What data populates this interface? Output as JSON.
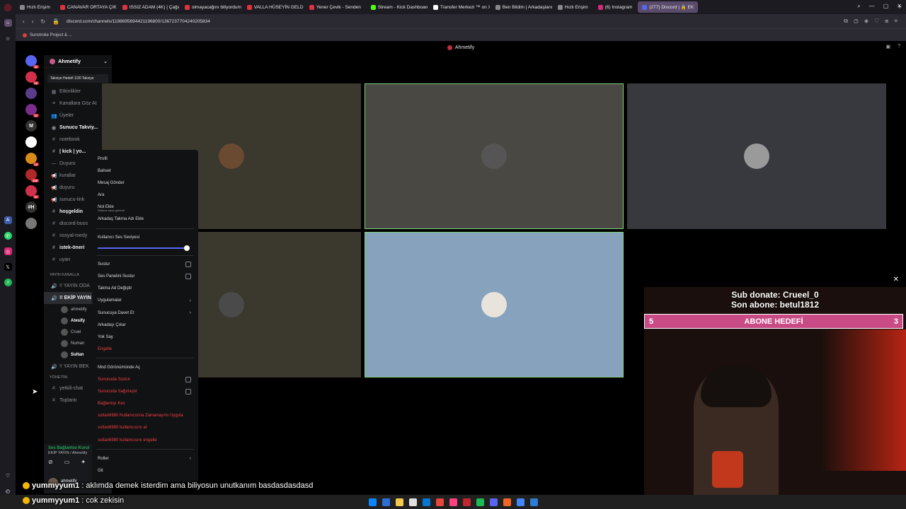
{
  "browser": {
    "tabs": [
      {
        "label": "Hızlı Erişim",
        "color": "#888888"
      },
      {
        "label": "CANAVAR ORTAYA ÇIKTI",
        "color": "#e0333e"
      },
      {
        "label": "ISSIZ ADAM (4K) | Çağan",
        "color": "#e0333e"
      },
      {
        "label": "olmayacağını biliyordum",
        "color": "#e0333e"
      },
      {
        "label": "VALLA HÜSEYİN GELDİ &",
        "color": "#e0333e"
      },
      {
        "label": "Yener Çevik - Senden",
        "color": "#e0333e"
      },
      {
        "label": "Stream - Kick Dashboard",
        "color": "#53fc18"
      },
      {
        "label": "Transfer Merkezi ™ on X",
        "color": "#ffffff"
      },
      {
        "label": "Ben Bildim | Arkadaşlarını",
        "color": "#888888"
      },
      {
        "label": "Hızlı Erişim",
        "color": "#888888"
      },
      {
        "label": "(6) Instagram",
        "color": "#d62976"
      },
      {
        "label": "(277) Discord | 🔒 EK",
        "color": "#5865f2",
        "active": true
      }
    ],
    "url": "discord.com/channels/1198695694421196800/1367237704240205834",
    "bookmark": "Sunstroke Project & ..."
  },
  "discord": {
    "title": "Ahmetify",
    "server_name": "Ahmetify",
    "boost_text": "Takviye Hedefi 1/20 Takviye",
    "guilds": [
      {
        "label": "",
        "badge": "41",
        "color": "#5865f2"
      },
      {
        "label": "",
        "badge": "16",
        "color": "#d0304a"
      },
      {
        "label": "",
        "badge": "",
        "color": "#5a3d8a"
      },
      {
        "label": "",
        "badge": "27",
        "color": "#7a2d8a"
      },
      {
        "label": "M",
        "badge": "",
        "color": "#333333"
      },
      {
        "label": "",
        "badge": "",
        "color": "#ffffff"
      },
      {
        "label": "",
        "badge": "10",
        "color": "#d88a18"
      },
      {
        "label": "",
        "badge": "160",
        "color": "#b02828"
      },
      {
        "label": "",
        "badge": "27",
        "color": "#d0304a"
      },
      {
        "label": "#H",
        "badge": "",
        "color": "#333333"
      },
      {
        "label": "",
        "badge": "",
        "color": "#777777"
      }
    ],
    "channels": [
      {
        "icon": "▦",
        "label": "Etkinlikler",
        "bright": false
      },
      {
        "icon": "≡",
        "label": "Kanallara Göz At",
        "bright": false
      },
      {
        "icon": "👥",
        "label": "Üyeler",
        "bright": false
      },
      {
        "icon": "◉",
        "label": "Sunucu Takviy...",
        "bright": true
      },
      {
        "icon": "#",
        "label": "notebook",
        "bright": false
      },
      {
        "icon": "#",
        "label": "| kick | yo...",
        "bright": true
      },
      {
        "icon": "—",
        "label": "Duyuru",
        "bright": false
      },
      {
        "icon": "📢",
        "label": "kurallar",
        "bright": false
      },
      {
        "icon": "📢",
        "label": "duyuru",
        "bright": false
      },
      {
        "icon": "📢",
        "label": "sunucu-link",
        "bright": false
      },
      {
        "icon": "#",
        "label": "hoşgeldin",
        "bright": true
      },
      {
        "icon": "#",
        "label": "discord-boos",
        "bright": false
      },
      {
        "icon": "#",
        "label": "sosyal-medy",
        "bright": false
      },
      {
        "icon": "#",
        "label": "istek-öneri",
        "bright": true
      },
      {
        "icon": "#",
        "label": "uyarı",
        "bright": false
      }
    ],
    "categories": {
      "yayin": "YAYIN KANALLA",
      "yayin_oda": "!! YAYIN ODA",
      "ekip": "!! EKİP YAYIN",
      "yayin_bek": "!! YAYIN BEK",
      "yonetim": "YÖNETİM"
    },
    "voice_users": [
      {
        "name": "ahmetify",
        "active": false
      },
      {
        "name": "Atesify",
        "active": true
      },
      {
        "name": "Cruel",
        "active": false
      },
      {
        "name": "Numan",
        "active": false
      },
      {
        "name": "Sultan",
        "active": true
      }
    ],
    "channels_lower": [
      {
        "icon": "#",
        "label": "yetkili-chat"
      },
      {
        "icon": "#",
        "label": "Toplantı"
      }
    ],
    "voicebar": {
      "status": "Ses Bağlantısı Kurul",
      "room": "EKİP YAYIN / Ahmetify"
    },
    "user": {
      "name": "ahmetify",
      "status": "Şu an ..."
    },
    "tiles": [
      {
        "bg": "#3b382e",
        "border": "#3b382e",
        "avatar": "#6a4a30"
      },
      {
        "bg": "#4a4843",
        "border": "#7fd07f",
        "avatar": "#555555"
      },
      {
        "bg": "#37393e",
        "border": "#37393e",
        "avatar": "#9a9a9a"
      },
      {
        "bg": "#3b382e",
        "border": "#3b382e",
        "avatar": "#4a4a4a"
      },
      {
        "bg": "#86a2bd",
        "border": "#7fd07f",
        "avatar": "#e8e4dc"
      }
    ]
  },
  "context_menu": {
    "items": [
      {
        "label": "Profil",
        "type": "normal"
      },
      {
        "label": "Bahset",
        "type": "normal"
      },
      {
        "label": "Mesaj Gönder",
        "type": "normal"
      },
      {
        "label": "Ara",
        "type": "normal"
      },
      {
        "label": "Not Ekle",
        "type": "sub",
        "sub": "Sadece sana görünür"
      },
      {
        "label": "Arkadaş Takma Adı Ekle",
        "type": "normal"
      },
      {
        "label": "---",
        "type": "sep"
      },
      {
        "label": "Kullanıcı Ses Seviyesi",
        "type": "normal"
      },
      {
        "label": "",
        "type": "slider"
      },
      {
        "label": "---",
        "type": "sep"
      },
      {
        "label": "Sustur",
        "type": "check"
      },
      {
        "label": "Ses Panelini Sustur",
        "type": "check"
      },
      {
        "label": "Takma Ad Değiştir",
        "type": "normal"
      },
      {
        "label": "Uygulamalar",
        "type": "arrow"
      },
      {
        "label": "Sunucuya Davet Et",
        "type": "arrow"
      },
      {
        "label": "Arkadaşı Çıkar",
        "type": "normal"
      },
      {
        "label": "Yok Say",
        "type": "normal"
      },
      {
        "label": "Engelle",
        "type": "red"
      },
      {
        "label": "---",
        "type": "sep"
      },
      {
        "label": "Mod Görünümünde Aç",
        "type": "normal"
      },
      {
        "label": "Sunucuda Sustur",
        "type": "redcheck"
      },
      {
        "label": "Sunucuda Sağırlaştır",
        "type": "redcheck"
      },
      {
        "label": "Bağlantıyı Kes",
        "type": "red"
      },
      {
        "label": "sultan6980 Kullanıcısına Zamanaşımı Uygula",
        "type": "red"
      },
      {
        "label": "sultan6980 kullanıcısını at",
        "type": "red"
      },
      {
        "label": "sultan6980 kullanıcısını engelle",
        "type": "red"
      },
      {
        "label": "---",
        "type": "sep"
      },
      {
        "label": "Roller",
        "type": "arrow"
      },
      {
        "label": "Git",
        "type": "normal"
      }
    ],
    "volume_level": 1.0
  },
  "stream_overlay": {
    "sub_donate": "Sub donate: Crueel_0",
    "last_sub": "Son abone: betul1812",
    "goal_label": "ABONE HEDEFİ",
    "goal_current": "5",
    "goal_target": "3"
  },
  "chat": [
    {
      "user": "yummyyum1",
      "text": ": aklımda demek isterdim ama biliyosun unutkanım basdasdasdasd"
    },
    {
      "user": "yummyyum1",
      "text": ": cok zekisin"
    }
  ],
  "taskbar_icons": [
    "#0a84ff",
    "#2b6fd6",
    "#f2c94c",
    "#e0e0e0",
    "#0078d4",
    "#e8453c",
    "#ff4081",
    "#c1272d",
    "#1db954",
    "#5865f2",
    "#f26522",
    "#4285f4",
    "#2d7cd6"
  ]
}
